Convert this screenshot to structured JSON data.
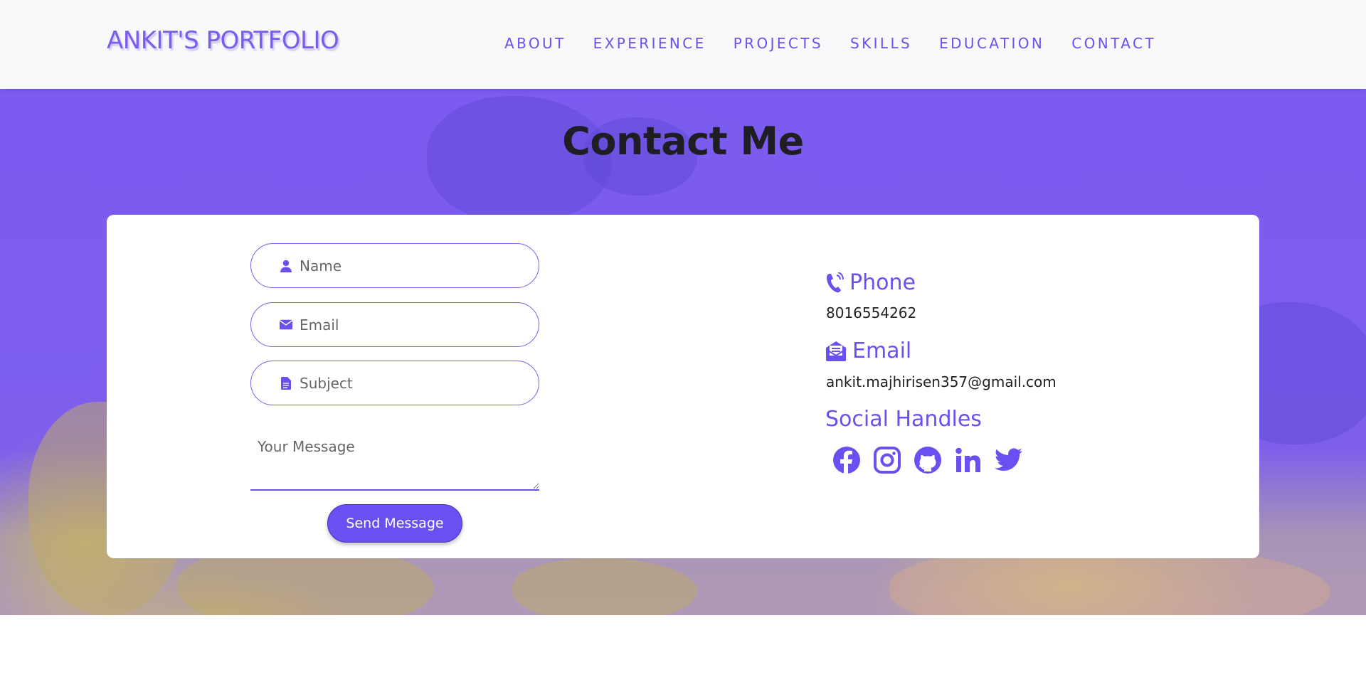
{
  "header": {
    "brand": "ANKIT'S PORTFOLIO",
    "nav": [
      {
        "label": "ABOUT"
      },
      {
        "label": "EXPERIENCE"
      },
      {
        "label": "PROJECTS"
      },
      {
        "label": "SKILLS"
      },
      {
        "label": "EDUCATION"
      },
      {
        "label": "CONTACT"
      }
    ]
  },
  "contact": {
    "title": "Contact Me",
    "form": {
      "name_placeholder": "Name",
      "email_placeholder": "Email",
      "subject_placeholder": "Subject",
      "message_placeholder": "Your Message",
      "send_label": "Send Message"
    },
    "info": {
      "phone_heading": "Phone",
      "phone_value": "8016554262",
      "email_heading": "Email",
      "email_value": "ankit.majhirisen357@gmail.com",
      "social_heading": "Social Handles",
      "social_icons": [
        "facebook-icon",
        "instagram-icon",
        "github-icon",
        "linkedin-icon",
        "twitter-icon"
      ]
    }
  },
  "colors": {
    "accent": "#6c4ff0",
    "header_bg": "#f8f9fa",
    "title_text": "#1e1e24"
  }
}
